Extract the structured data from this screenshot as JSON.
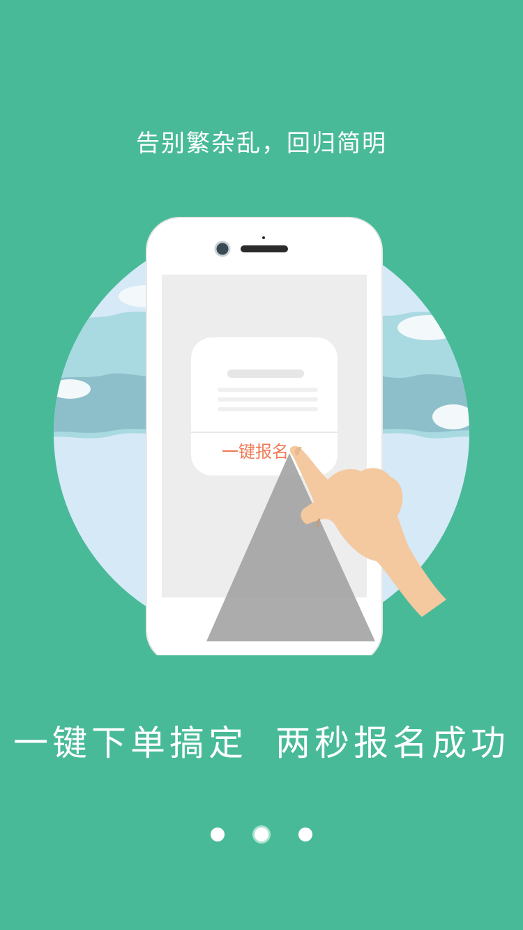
{
  "onboarding": {
    "subtitle": "告别繁杂乱，回归简明",
    "headline_part1": "一键下单搞定",
    "headline_part2": "两秒报名成功",
    "mockup_button_label": "一键报名",
    "page_count": 3,
    "active_page": 2
  },
  "colors": {
    "background": "#49BA98",
    "accent_text": "#F07A55",
    "hand": "#F4C9A0",
    "sky": "#D6E9F7"
  }
}
